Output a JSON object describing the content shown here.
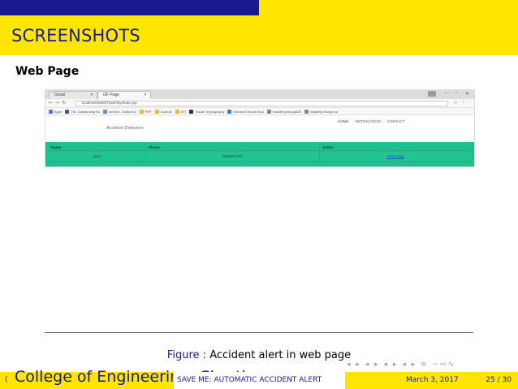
{
  "frame": {
    "title": "SCREENSHOTS",
    "block_title": "Web Page"
  },
  "browser": {
    "tabs": [
      {
        "label": "Gmail"
      },
      {
        "label": "GF Page"
      }
    ],
    "url": "localhost:8080/Track/My/index.jsp",
    "bookmarks": [
      {
        "label": "Apps",
        "color": "#4a7bd8"
      },
      {
        "label": "TBI: Outstanding Bo",
        "color": "#3b5998"
      },
      {
        "label": "surfunit - Brilliant &",
        "color": "#5b8fd8"
      },
      {
        "label": "PHP",
        "color": "#e8b93a"
      },
      {
        "label": "Android",
        "color": "#e8b93a"
      },
      {
        "label": "IOT",
        "color": "#e8b93a"
      },
      {
        "label": "Visual Cryptography",
        "color": "#333333"
      },
      {
        "label": "Microsoft Visual Stud",
        "color": "#3a7bd5"
      },
      {
        "label": "Installing MongoDB",
        "color": "#888888"
      },
      {
        "label": "Installing Mongo on",
        "color": "#888888"
      }
    ],
    "site": {
      "brand": "Accident Detection",
      "nav": [
        "HOME",
        "NOTIFICATION",
        "CONTACT"
      ]
    },
    "table": {
      "headers": [
        "Name",
        "Phone",
        "Action"
      ],
      "rows": [
        {
          "name": "arun",
          "phone": "8089517923",
          "action": "Show Map"
        }
      ]
    }
  },
  "caption": {
    "label": "Figure :",
    "text": "Accident alert in web page"
  },
  "beamer_nav": "◂ ▸ ◂ ▸ ◂ ▸ ◂ ▸ ≡ ∽∾∿",
  "footer": {
    "paren": "(",
    "institute": "College of Engineering, Chertha",
    "title": "SAVE ME: AUTOMATIC ACCIDENT ALERT",
    "date": "March 3, 2017",
    "page": "25 / 30"
  },
  "colors": {
    "navy": "#1a1a8c",
    "yellow": "#ffe600",
    "table_green": "#1fbf8f"
  }
}
